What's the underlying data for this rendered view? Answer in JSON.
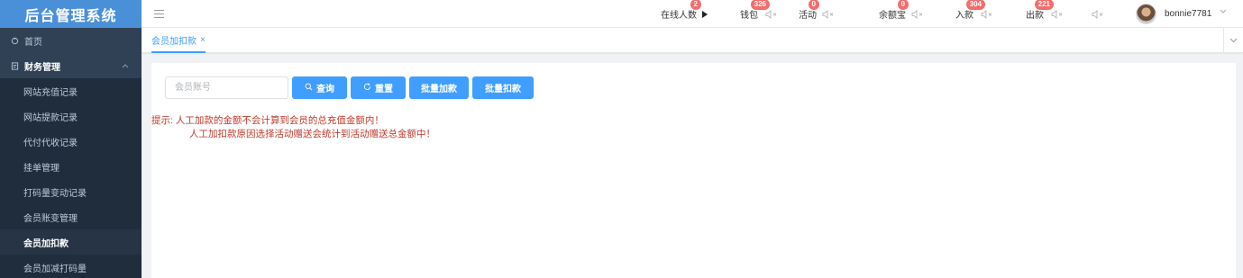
{
  "app": {
    "title": "后台管理系统"
  },
  "sidebar": {
    "home": {
      "label": "首页"
    },
    "group": {
      "label": "财务管理"
    },
    "items": [
      {
        "label": "网站充值记录"
      },
      {
        "label": "网站提款记录"
      },
      {
        "label": "代付代收记录"
      },
      {
        "label": "挂单管理"
      },
      {
        "label": "打码量变动记录"
      },
      {
        "label": "会员账变管理"
      },
      {
        "label": "会员加扣款",
        "active": true
      },
      {
        "label": "会员加减打码量"
      }
    ]
  },
  "header": {
    "stats": [
      {
        "label": "在线人数",
        "badge": "2",
        "control": "play"
      },
      {
        "label": "钱包",
        "badge": "326",
        "control": "mute"
      },
      {
        "label": "活动",
        "badge": "0",
        "control": "mute"
      },
      {
        "label": "余额宝",
        "badge": "0",
        "control": "mute"
      },
      {
        "label": "入款",
        "badge": "304",
        "control": "mute"
      },
      {
        "label": "出款",
        "badge": "221",
        "control": "mute"
      }
    ],
    "extra_mute_icon": "speaker-mute-icon",
    "username": "bonnie7781"
  },
  "tabs": [
    {
      "label": "会员加扣款",
      "close": "×"
    }
  ],
  "toolbar": {
    "account_placeholder": "会员账号",
    "account_value": "",
    "search_label": "查询",
    "reset_label": "重置",
    "batch_add_label": "批量加款",
    "batch_deduct_label": "批量扣款"
  },
  "tip": {
    "line1": "提示: 人工加款的金额不会计算到会员的总充值金额内！",
    "line2": "人工加扣款原因选择活动赠送会统计到活动赠送总金额中！"
  },
  "colors": {
    "sidebar_bg": "#304156",
    "logo_bg": "#4a90d9",
    "primary": "#409eff",
    "badge": "#f56c6c",
    "tip": "#c0392b"
  }
}
